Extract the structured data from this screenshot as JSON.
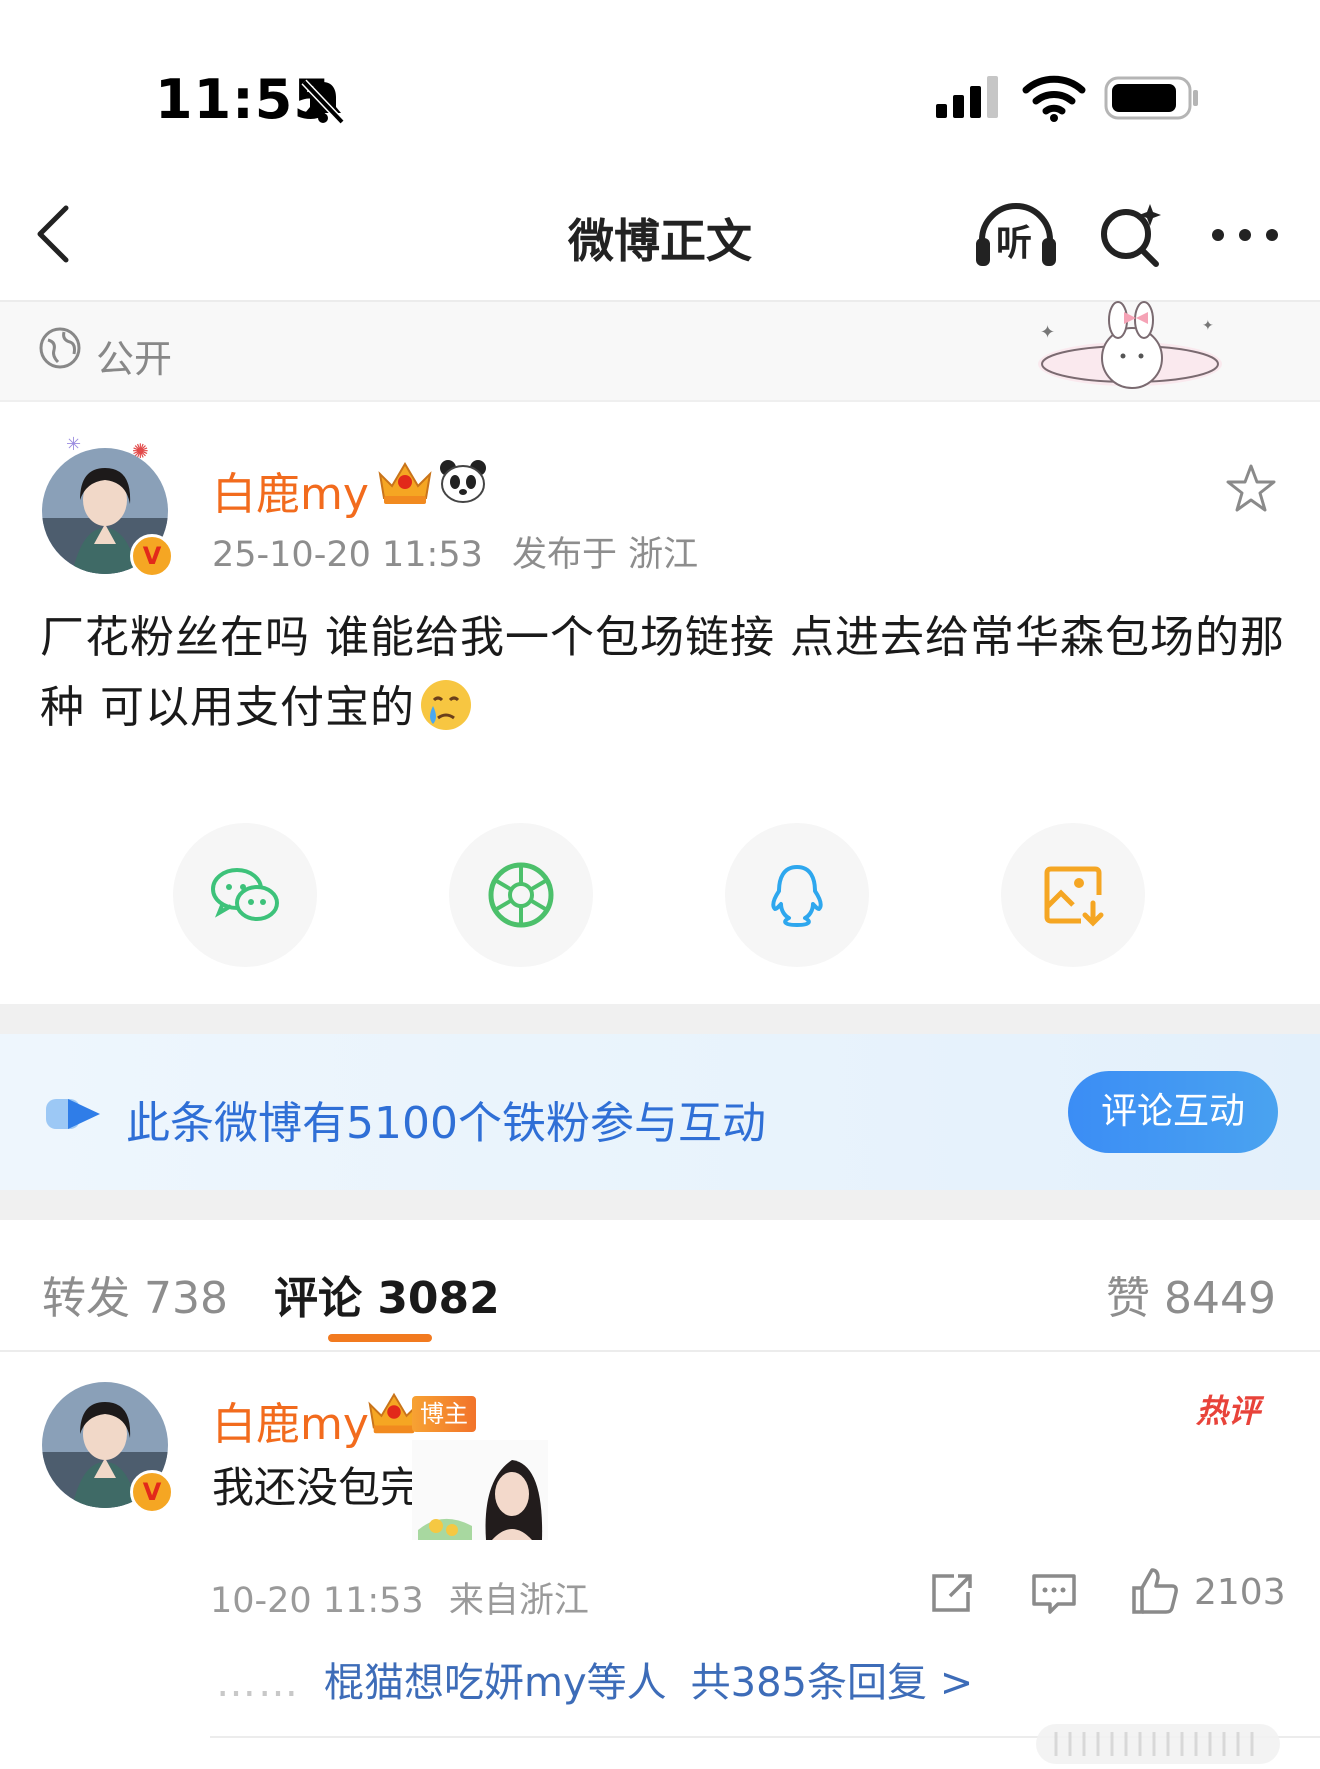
{
  "status_bar": {
    "time": "11:55"
  },
  "nav": {
    "title": "微博正文",
    "listen_label": "听"
  },
  "visibility": {
    "label": "公开"
  },
  "post": {
    "author": "白鹿my",
    "timestamp": "25-10-20 11:53",
    "location": "发布于 浙江",
    "text": "厂花粉丝在吗 谁能给我一个包场链接 点进去给常华森包场的那种 可以用支付宝的",
    "verified_mark": "V"
  },
  "share_targets": [
    {
      "name": "wechat-icon"
    },
    {
      "name": "moments-icon"
    },
    {
      "name": "qq-icon"
    },
    {
      "name": "save-image-icon"
    }
  ],
  "fan_banner": {
    "text": "此条微博有5100个铁粉参与互动",
    "button": "评论互动"
  },
  "tabs": {
    "repost": "转发 738",
    "comment": "评论 3082",
    "like": "赞 8449"
  },
  "comment": {
    "author": "白鹿my",
    "badge": "博主",
    "hot_label": "热评",
    "text": "我还没包完",
    "time": "10-20 11:53",
    "source": "来自浙江",
    "likes": "2103",
    "replies_users": "棍猫想吃妍my等人",
    "replies_count": "共385条回复 >",
    "verified_mark": "V"
  },
  "colors": {
    "accent_orange": "#f26b1d",
    "link_blue": "#3d6cb8",
    "banner_blue": "#2f6fd6"
  }
}
